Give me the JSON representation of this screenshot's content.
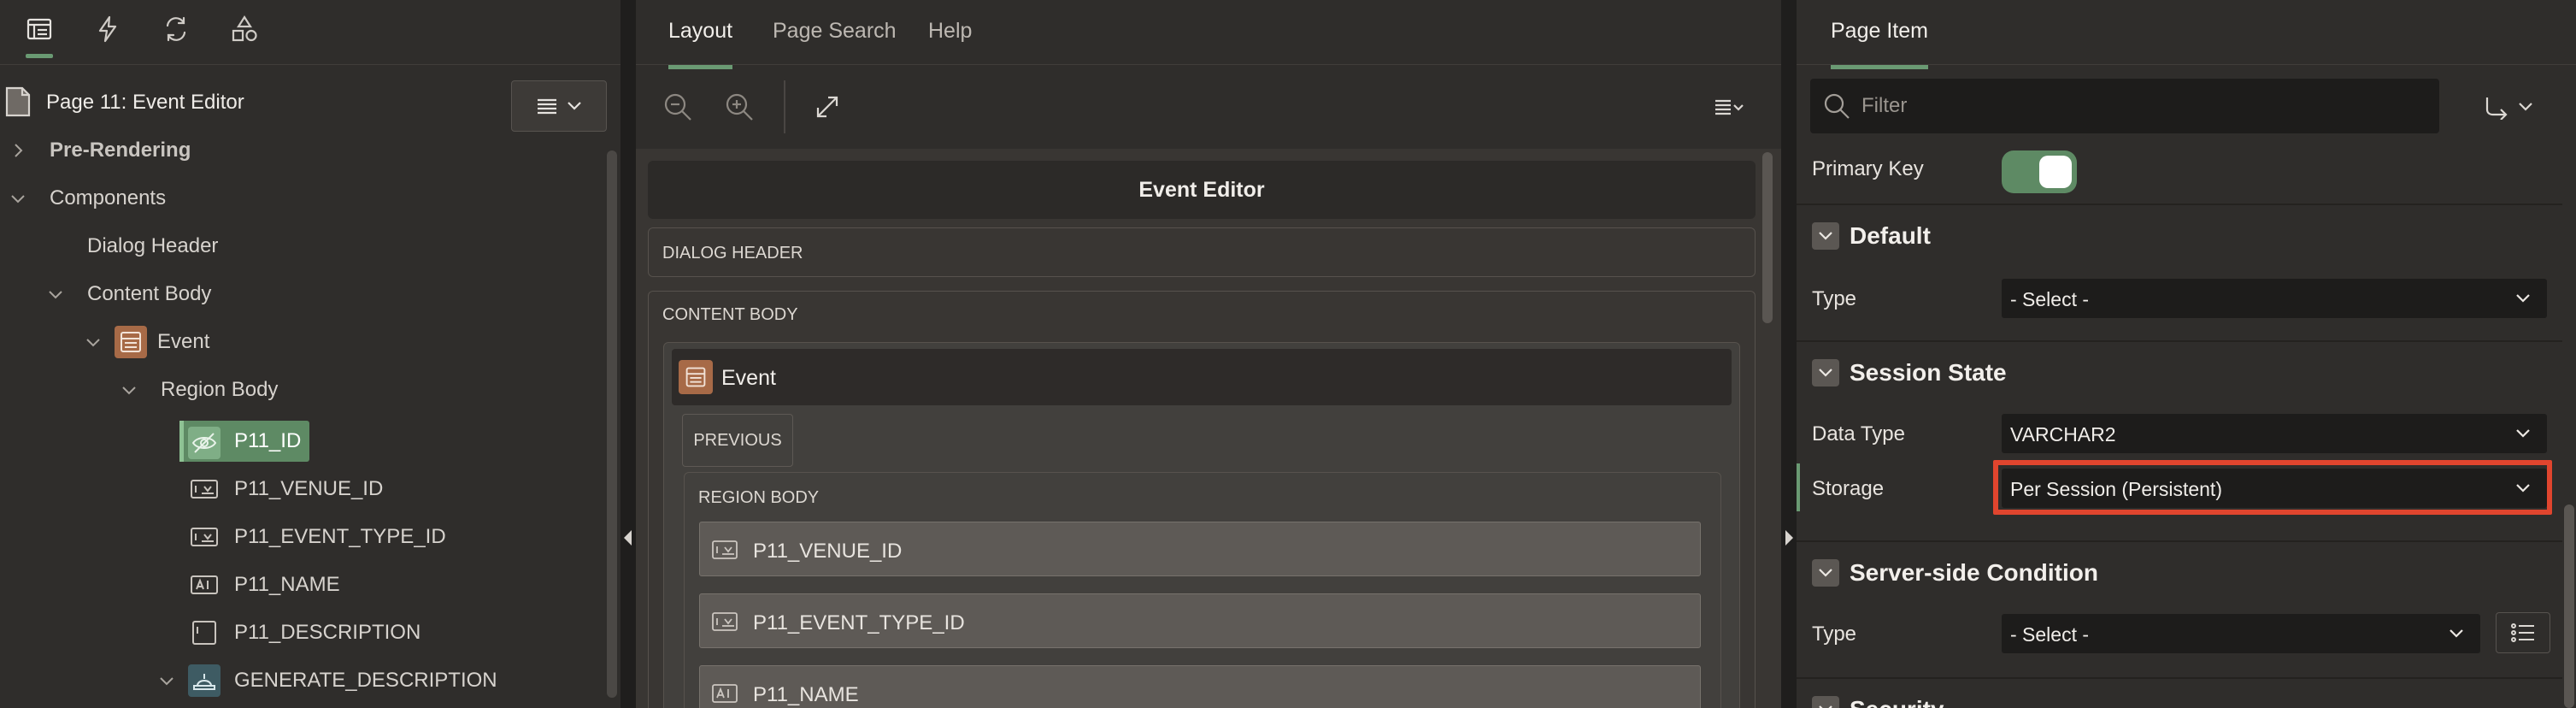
{
  "left": {
    "page_title": "Page 11: Event Editor",
    "tree": {
      "pre_rendering": "Pre-Rendering",
      "components": "Components",
      "dialog_header": "Dialog Header",
      "content_body": "Content Body",
      "event": "Event",
      "region_body": "Region Body",
      "p11_id": "P11_ID",
      "p11_venue_id": "P11_VENUE_ID",
      "p11_event_type_id": "P11_EVENT_TYPE_ID",
      "p11_name": "P11_NAME",
      "p11_description": "P11_DESCRIPTION",
      "generate_description": "GENERATE_DESCRIPTION"
    }
  },
  "middle": {
    "tabs": [
      "Layout",
      "Page Search",
      "Help"
    ],
    "grid_title": "Event Editor",
    "dialog_header": "DIALOG HEADER",
    "content_body": "CONTENT BODY",
    "event_region": "Event",
    "previous_button": "PREVIOUS",
    "region_body": "REGION BODY",
    "items": [
      "P11_VENUE_ID",
      "P11_EVENT_TYPE_ID",
      "P11_NAME"
    ]
  },
  "right": {
    "tab": "Page Item",
    "filter_placeholder": "Filter",
    "primary_key_label": "Primary Key",
    "primary_key_on": true,
    "sections": {
      "default": "Default",
      "session_state": "Session State",
      "server_side_condition": "Server-side Condition",
      "security": "Security"
    },
    "default_type_label": "Type",
    "default_type_value": "- Select -",
    "data_type_label": "Data Type",
    "data_type_value": "VARCHAR2",
    "storage_label": "Storage",
    "storage_value": "Per Session (Persistent)",
    "condition_type_label": "Type",
    "condition_type_value": "- Select -"
  },
  "colors": {
    "accent_green": "#6a9a73",
    "highlight_red": "#e0452e",
    "region_brown": "#a76a47"
  }
}
